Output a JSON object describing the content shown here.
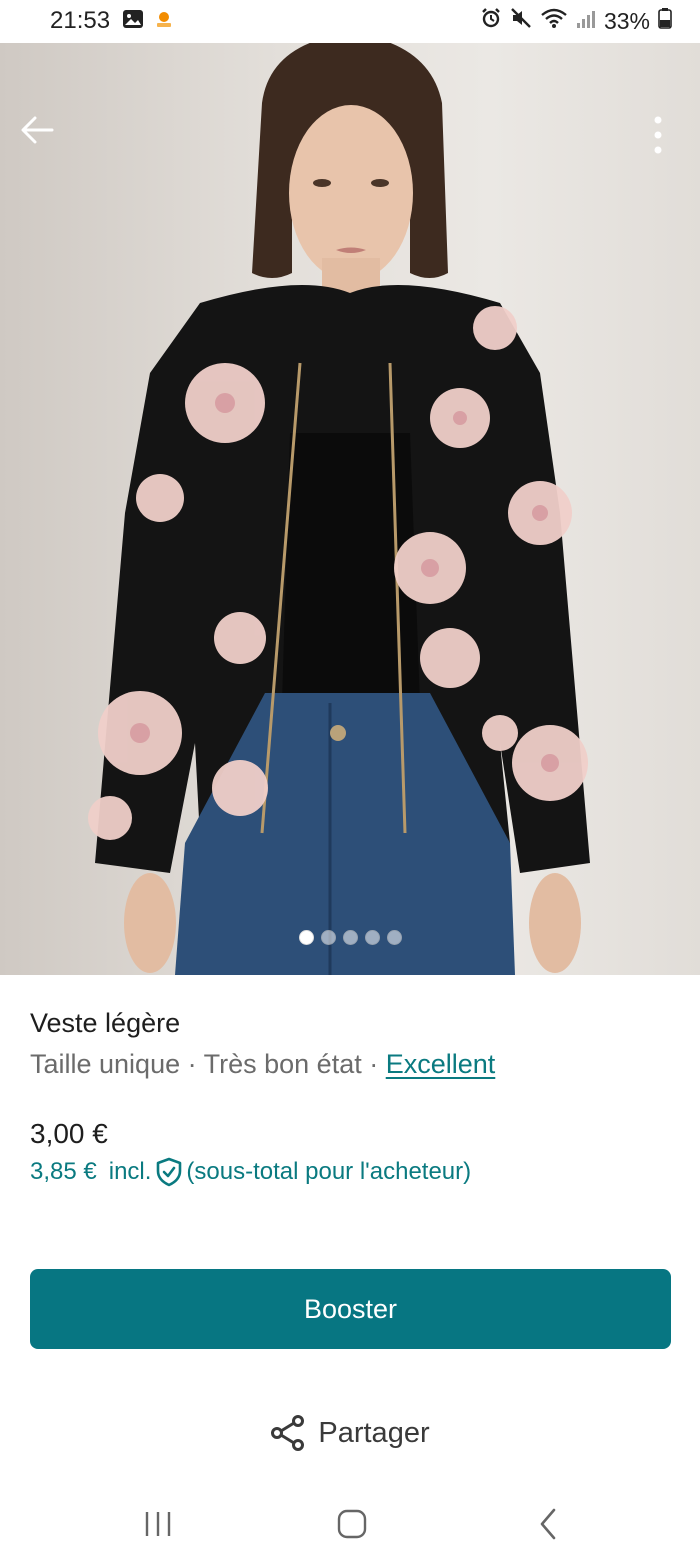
{
  "status_bar": {
    "time": "21:53",
    "battery": "33%",
    "icons": [
      "gallery-icon",
      "app-notification-icon",
      "alarm-icon",
      "mute-icon",
      "wifi-icon",
      "signal-icon",
      "battery-icon"
    ]
  },
  "gallery": {
    "image_count": 5,
    "active_index": 0
  },
  "item": {
    "title": "Veste légère",
    "size": "Taille unique",
    "separator": " · ",
    "condition": "Très bon état",
    "rating_link": "Excellent",
    "price": "3,00 €",
    "buyer_price": "3,85 €",
    "buyer_incl": "incl.",
    "buyer_note": "(sous-total pour l'acheteur)"
  },
  "actions": {
    "boost_label": "Booster",
    "share_label": "Partager"
  },
  "colors": {
    "accent": "#077682",
    "link": "#0a7a80",
    "text": "#1e1e1e",
    "muted": "#6b6b6b"
  }
}
